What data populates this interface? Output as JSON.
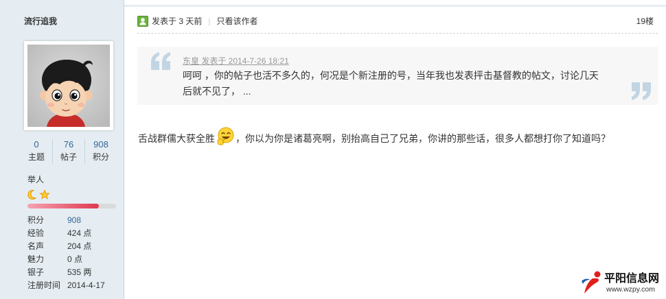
{
  "colors": {
    "sidebar_bg": "#E5EDF2",
    "sidebar_border": "#C2D5E3",
    "link": "#336699",
    "text": "#333333",
    "quote_bg": "#F7F7F7",
    "quote_mark": "#C2D5E3",
    "quote_meta": "#999999",
    "progress_start": "#F5A3B3",
    "progress_end": "#E0384F"
  },
  "sidebar": {
    "username": "流行追我",
    "avatar_icon": "cartoon-boy-avatar",
    "stats": [
      {
        "value": "0",
        "label": "主题"
      },
      {
        "value": "76",
        "label": "帖子"
      },
      {
        "value": "908",
        "label": "积分"
      }
    ],
    "rank": {
      "title": "举人",
      "stars": [
        "moon-icon",
        "star-icon"
      ],
      "progress": 0.81
    },
    "profile": [
      {
        "label": "积分",
        "value": "908"
      },
      {
        "label": "经验",
        "value": "424 点"
      },
      {
        "label": "名声",
        "value": "204 点"
      },
      {
        "label": "魅力",
        "value": "0 点"
      },
      {
        "label": "银子",
        "value": "535 两"
      },
      {
        "label": "注册时间",
        "value": "2014-4-17"
      }
    ]
  },
  "post": {
    "author_icon": "user-online-icon",
    "posted": "发表于 3 天前",
    "separator": "|",
    "only_author": "只看该作者",
    "floor": "19楼",
    "quote": {
      "meta": "东皇 发表于 2014-7-26 18:21",
      "lines": [
        "呵呵 ，你的帖子也活不多久的，何况是个新注册的号，当年我也发表抨击基督教的帖文，讨论几天",
        "后就不见了， ..."
      ]
    },
    "body": {
      "before": "舌战群儒大获全胜",
      "emoji": "grin-emoji-icon",
      "after": "，你以为你是诸葛亮啊，别抬高自己了兄弟，你讲的那些话，很多人都想打你了知道吗？"
    }
  },
  "watermark": {
    "logo_icon": "site-logo-icon",
    "name": "平阳信息网",
    "url": "www.wzpy.com"
  }
}
